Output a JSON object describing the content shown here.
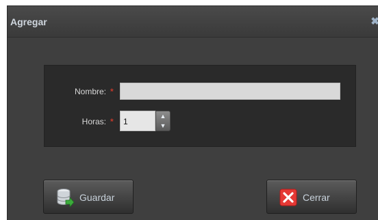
{
  "dialog": {
    "title": "Agregar",
    "close_glyph": "✖"
  },
  "form": {
    "nombre_label": "Nombre:",
    "nombre_required": "*",
    "nombre_value": "",
    "horas_label": "Horas:",
    "horas_required": "*",
    "horas_value": "1",
    "spin_up_glyph": "▲",
    "spin_down_glyph": "▼"
  },
  "buttons": {
    "guardar_label": "Guardar",
    "guardar_icon": "database-save-icon",
    "cerrar_label": "Cerrar",
    "cerrar_icon": "close-x-icon"
  },
  "colors": {
    "dialog_bg": "#3f3f3f",
    "panel_bg": "#2a2a2a",
    "required_star": "#c0392b",
    "title_text": "#cfd6de"
  }
}
